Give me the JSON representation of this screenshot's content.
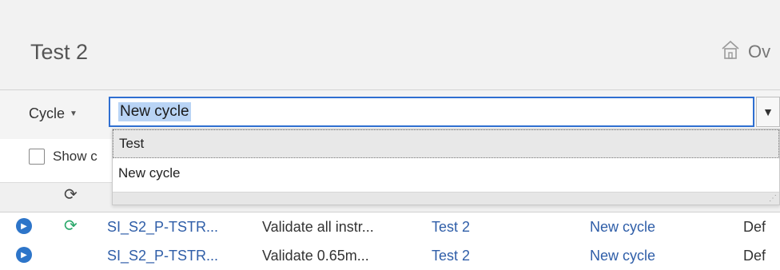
{
  "header": {
    "title": "Test 2",
    "home_label": "Ov",
    "home_icon": "home-icon"
  },
  "toolbar": {
    "cycle_menu_label": "Cycle",
    "cycle_input_value": "New cycle",
    "dropdown_options": [
      "Test",
      "New cycle"
    ],
    "show_checkbox_label": "Show c"
  },
  "grid": {
    "header_sync_icon": "sync-icon",
    "rows": [
      {
        "id_text": "SI_S2_P-TSTR...",
        "name_text": "Validate all instr...",
        "test": "Test 2",
        "cycle": "New cycle",
        "extra": "Def",
        "synced": true
      },
      {
        "id_text": "SI_S2_P-TSTR...",
        "name_text": "Validate 0.65m...",
        "test": "Test 2",
        "cycle": "New cycle",
        "extra": "Def",
        "synced": false
      }
    ]
  },
  "colors": {
    "accent_blue": "#2f6fd1",
    "link_blue": "#2f5ea8",
    "sync_green": "#2aa86a",
    "play_blue": "#2d75c9"
  }
}
